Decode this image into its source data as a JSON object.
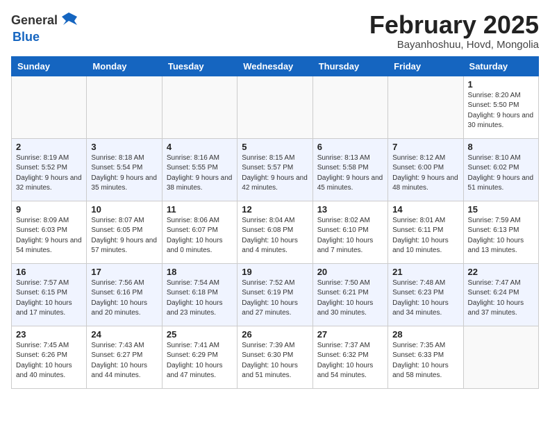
{
  "header": {
    "logo_general": "General",
    "logo_blue": "Blue",
    "month_title": "February 2025",
    "location": "Bayanhoshuu, Hovd, Mongolia"
  },
  "days_of_week": [
    "Sunday",
    "Monday",
    "Tuesday",
    "Wednesday",
    "Thursday",
    "Friday",
    "Saturday"
  ],
  "weeks": [
    [
      {
        "day": "",
        "info": ""
      },
      {
        "day": "",
        "info": ""
      },
      {
        "day": "",
        "info": ""
      },
      {
        "day": "",
        "info": ""
      },
      {
        "day": "",
        "info": ""
      },
      {
        "day": "",
        "info": ""
      },
      {
        "day": "1",
        "info": "Sunrise: 8:20 AM\nSunset: 5:50 PM\nDaylight: 9 hours and 30 minutes."
      }
    ],
    [
      {
        "day": "2",
        "info": "Sunrise: 8:19 AM\nSunset: 5:52 PM\nDaylight: 9 hours and 32 minutes."
      },
      {
        "day": "3",
        "info": "Sunrise: 8:18 AM\nSunset: 5:54 PM\nDaylight: 9 hours and 35 minutes."
      },
      {
        "day": "4",
        "info": "Sunrise: 8:16 AM\nSunset: 5:55 PM\nDaylight: 9 hours and 38 minutes."
      },
      {
        "day": "5",
        "info": "Sunrise: 8:15 AM\nSunset: 5:57 PM\nDaylight: 9 hours and 42 minutes."
      },
      {
        "day": "6",
        "info": "Sunrise: 8:13 AM\nSunset: 5:58 PM\nDaylight: 9 hours and 45 minutes."
      },
      {
        "day": "7",
        "info": "Sunrise: 8:12 AM\nSunset: 6:00 PM\nDaylight: 9 hours and 48 minutes."
      },
      {
        "day": "8",
        "info": "Sunrise: 8:10 AM\nSunset: 6:02 PM\nDaylight: 9 hours and 51 minutes."
      }
    ],
    [
      {
        "day": "9",
        "info": "Sunrise: 8:09 AM\nSunset: 6:03 PM\nDaylight: 9 hours and 54 minutes."
      },
      {
        "day": "10",
        "info": "Sunrise: 8:07 AM\nSunset: 6:05 PM\nDaylight: 9 hours and 57 minutes."
      },
      {
        "day": "11",
        "info": "Sunrise: 8:06 AM\nSunset: 6:07 PM\nDaylight: 10 hours and 0 minutes."
      },
      {
        "day": "12",
        "info": "Sunrise: 8:04 AM\nSunset: 6:08 PM\nDaylight: 10 hours and 4 minutes."
      },
      {
        "day": "13",
        "info": "Sunrise: 8:02 AM\nSunset: 6:10 PM\nDaylight: 10 hours and 7 minutes."
      },
      {
        "day": "14",
        "info": "Sunrise: 8:01 AM\nSunset: 6:11 PM\nDaylight: 10 hours and 10 minutes."
      },
      {
        "day": "15",
        "info": "Sunrise: 7:59 AM\nSunset: 6:13 PM\nDaylight: 10 hours and 13 minutes."
      }
    ],
    [
      {
        "day": "16",
        "info": "Sunrise: 7:57 AM\nSunset: 6:15 PM\nDaylight: 10 hours and 17 minutes."
      },
      {
        "day": "17",
        "info": "Sunrise: 7:56 AM\nSunset: 6:16 PM\nDaylight: 10 hours and 20 minutes."
      },
      {
        "day": "18",
        "info": "Sunrise: 7:54 AM\nSunset: 6:18 PM\nDaylight: 10 hours and 23 minutes."
      },
      {
        "day": "19",
        "info": "Sunrise: 7:52 AM\nSunset: 6:19 PM\nDaylight: 10 hours and 27 minutes."
      },
      {
        "day": "20",
        "info": "Sunrise: 7:50 AM\nSunset: 6:21 PM\nDaylight: 10 hours and 30 minutes."
      },
      {
        "day": "21",
        "info": "Sunrise: 7:48 AM\nSunset: 6:23 PM\nDaylight: 10 hours and 34 minutes."
      },
      {
        "day": "22",
        "info": "Sunrise: 7:47 AM\nSunset: 6:24 PM\nDaylight: 10 hours and 37 minutes."
      }
    ],
    [
      {
        "day": "23",
        "info": "Sunrise: 7:45 AM\nSunset: 6:26 PM\nDaylight: 10 hours and 40 minutes."
      },
      {
        "day": "24",
        "info": "Sunrise: 7:43 AM\nSunset: 6:27 PM\nDaylight: 10 hours and 44 minutes."
      },
      {
        "day": "25",
        "info": "Sunrise: 7:41 AM\nSunset: 6:29 PM\nDaylight: 10 hours and 47 minutes."
      },
      {
        "day": "26",
        "info": "Sunrise: 7:39 AM\nSunset: 6:30 PM\nDaylight: 10 hours and 51 minutes."
      },
      {
        "day": "27",
        "info": "Sunrise: 7:37 AM\nSunset: 6:32 PM\nDaylight: 10 hours and 54 minutes."
      },
      {
        "day": "28",
        "info": "Sunrise: 7:35 AM\nSunset: 6:33 PM\nDaylight: 10 hours and 58 minutes."
      },
      {
        "day": "",
        "info": ""
      }
    ]
  ]
}
